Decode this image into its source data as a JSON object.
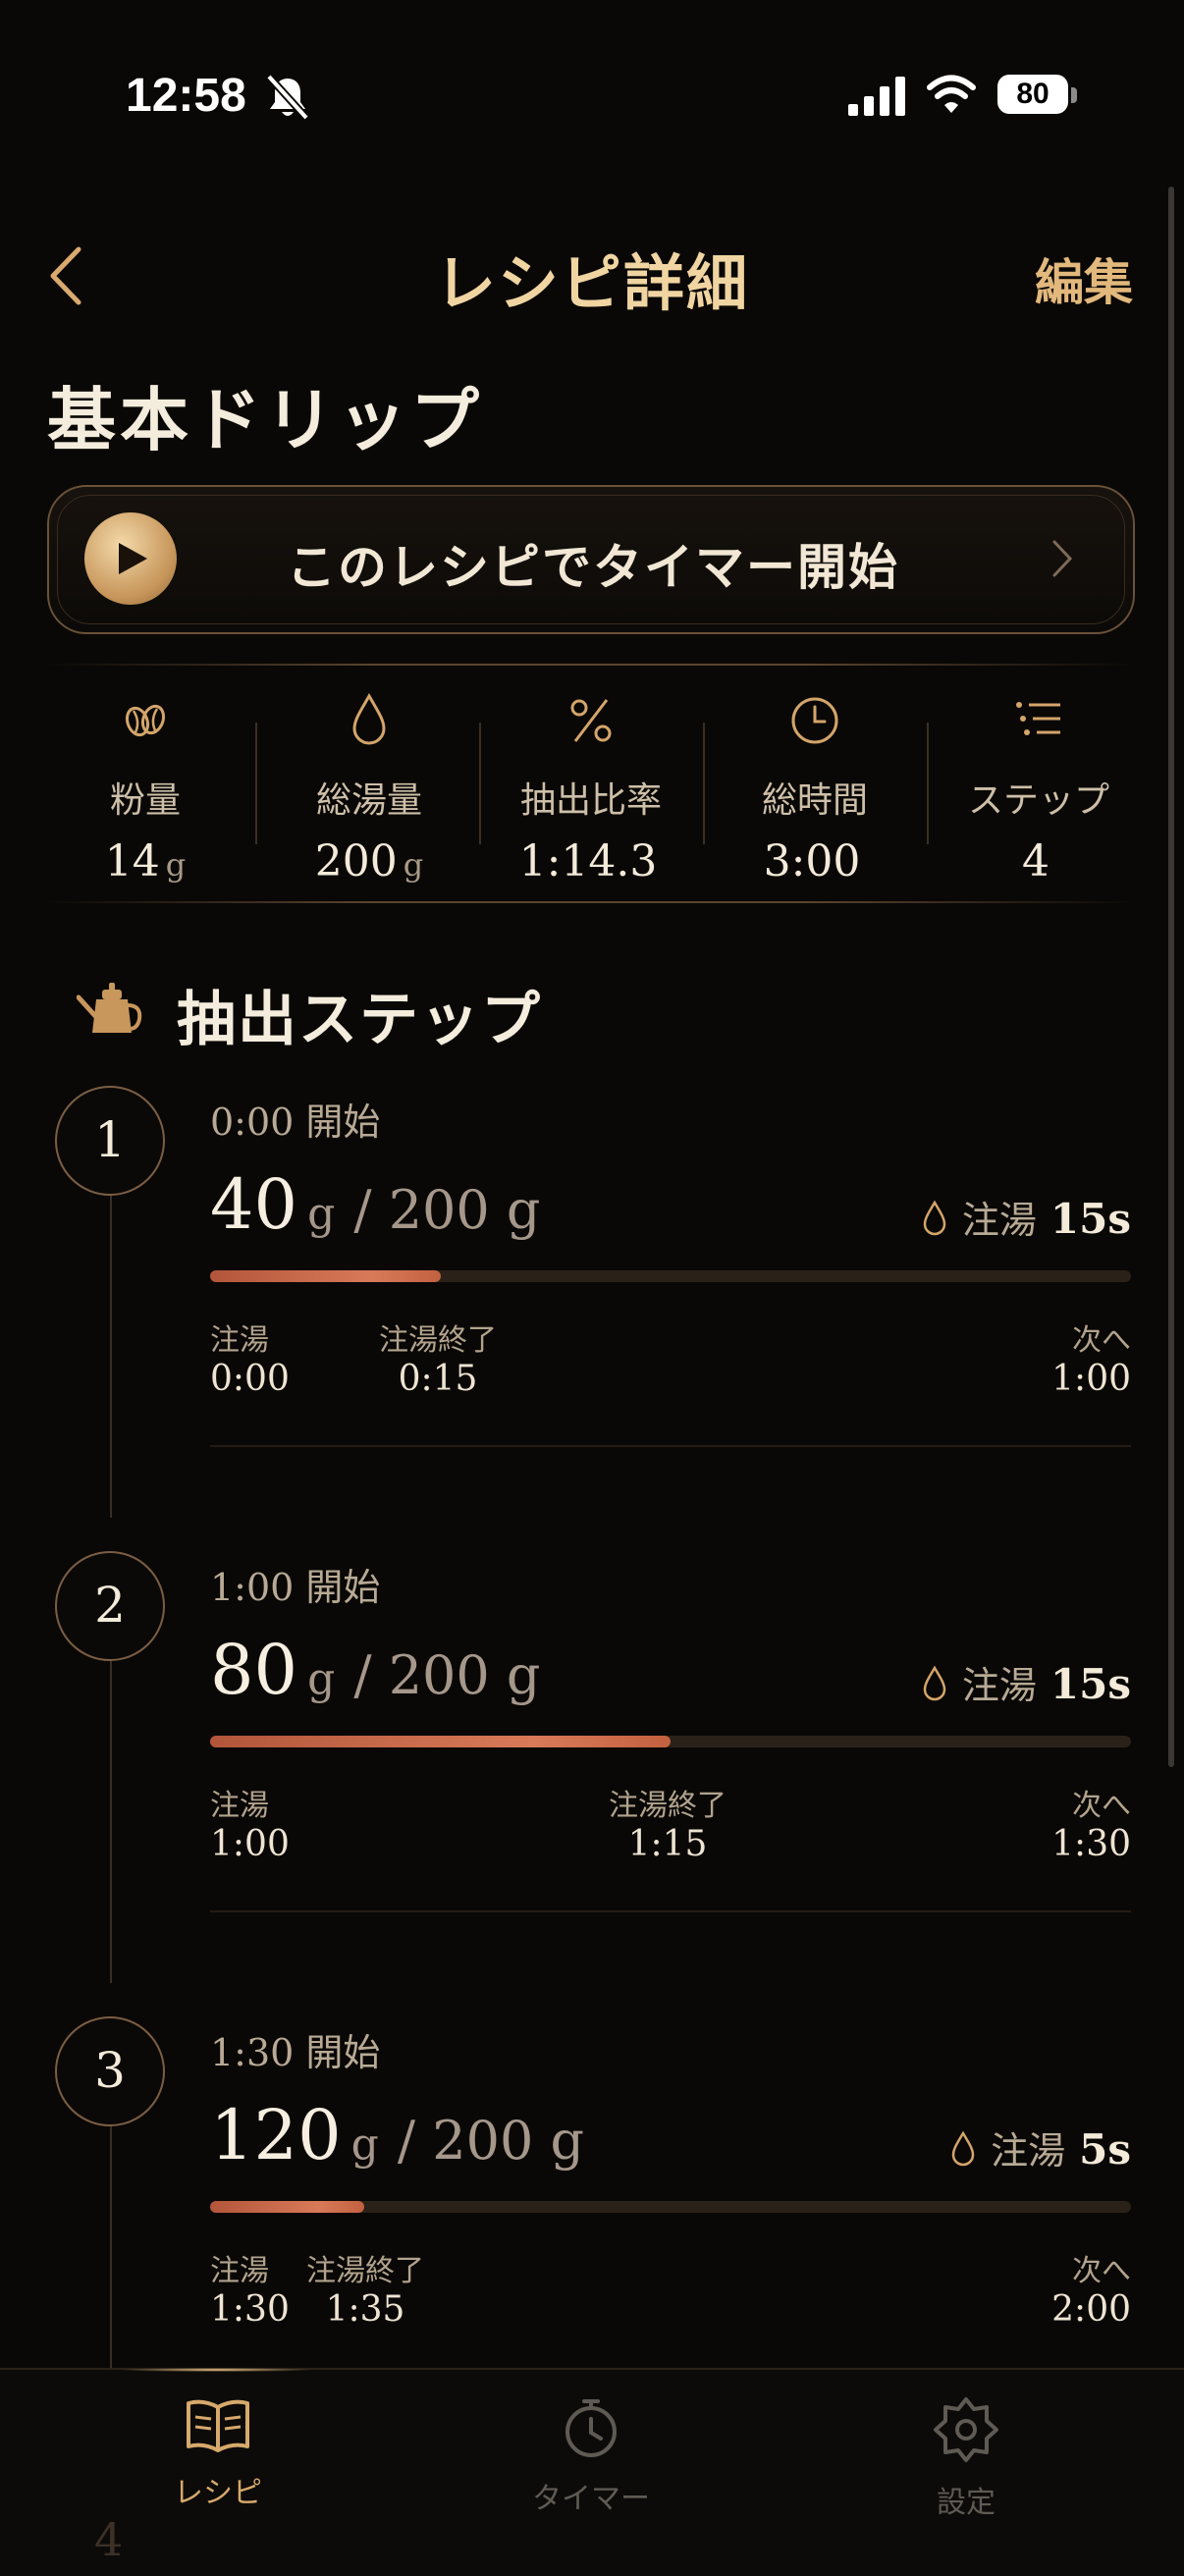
{
  "status_bar": {
    "time": "12:58",
    "battery": "80",
    "bell_icon": "bell-slash-icon",
    "signal_icon": "cellular-signal-icon",
    "wifi_icon": "wifi-icon"
  },
  "nav": {
    "title": "レシピ詳細",
    "edit_label": "編集",
    "back_icon": "chevron-left-icon"
  },
  "recipe": {
    "name": "基本ドリップ"
  },
  "timer_button": {
    "label": "このレシピでタイマー開始",
    "play_icon": "play-icon",
    "chevron_icon": "chevron-right-icon"
  },
  "stats": [
    {
      "icon": "coffee-beans-icon",
      "label": "粉量",
      "value": "14",
      "unit": "g"
    },
    {
      "icon": "water-drop-icon",
      "label": "総湯量",
      "value": "200",
      "unit": "g"
    },
    {
      "icon": "percent-icon",
      "label": "抽出比率",
      "value": "1:14.3",
      "unit": ""
    },
    {
      "icon": "clock-icon",
      "label": "総時間",
      "value": "3:00",
      "unit": ""
    },
    {
      "icon": "steps-list-icon",
      "label": "ステップ",
      "value": "4",
      "unit": ""
    }
  ],
  "section": {
    "title": "抽出ステップ",
    "icon": "kettle-icon"
  },
  "steps": [
    {
      "number": "1",
      "start": "0:00 開始",
      "amount": "40",
      "unit": "g",
      "total": "/ 200 g",
      "pour_label": "注湯",
      "pour_time": "15s",
      "progress": 0.25,
      "marks": [
        {
          "label": "注湯",
          "time": "0:00"
        },
        {
          "label": "注湯終了",
          "time": "0:15"
        },
        {
          "label": "次へ",
          "time": "1:00"
        }
      ]
    },
    {
      "number": "2",
      "start": "1:00 開始",
      "amount": "80",
      "unit": "g",
      "total": "/ 200 g",
      "pour_label": "注湯",
      "pour_time": "15s",
      "progress": 0.5,
      "marks": [
        {
          "label": "注湯",
          "time": "1:00"
        },
        {
          "label": "注湯終了",
          "time": "1:15"
        },
        {
          "label": "次へ",
          "time": "1:30"
        }
      ]
    },
    {
      "number": "3",
      "start": "1:30 開始",
      "amount": "120",
      "unit": "g",
      "total": "/ 200 g",
      "pour_label": "注湯",
      "pour_time": "5s",
      "progress": 0.167,
      "marks": [
        {
          "label": "注湯",
          "time": "1:30"
        },
        {
          "label": "注湯終了",
          "time": "1:35"
        },
        {
          "label": "次へ",
          "time": "2:00"
        }
      ]
    },
    {
      "number": "4"
    }
  ],
  "tabs": [
    {
      "label": "レシピ",
      "icon": "book-icon",
      "active": true
    },
    {
      "label": "タイマー",
      "icon": "stopwatch-icon",
      "active": false
    },
    {
      "label": "設定",
      "icon": "gear-icon",
      "active": false
    }
  ],
  "colors": {
    "accent": "#e2b87c",
    "progress": "#d87a58",
    "background": "#0a0806"
  }
}
